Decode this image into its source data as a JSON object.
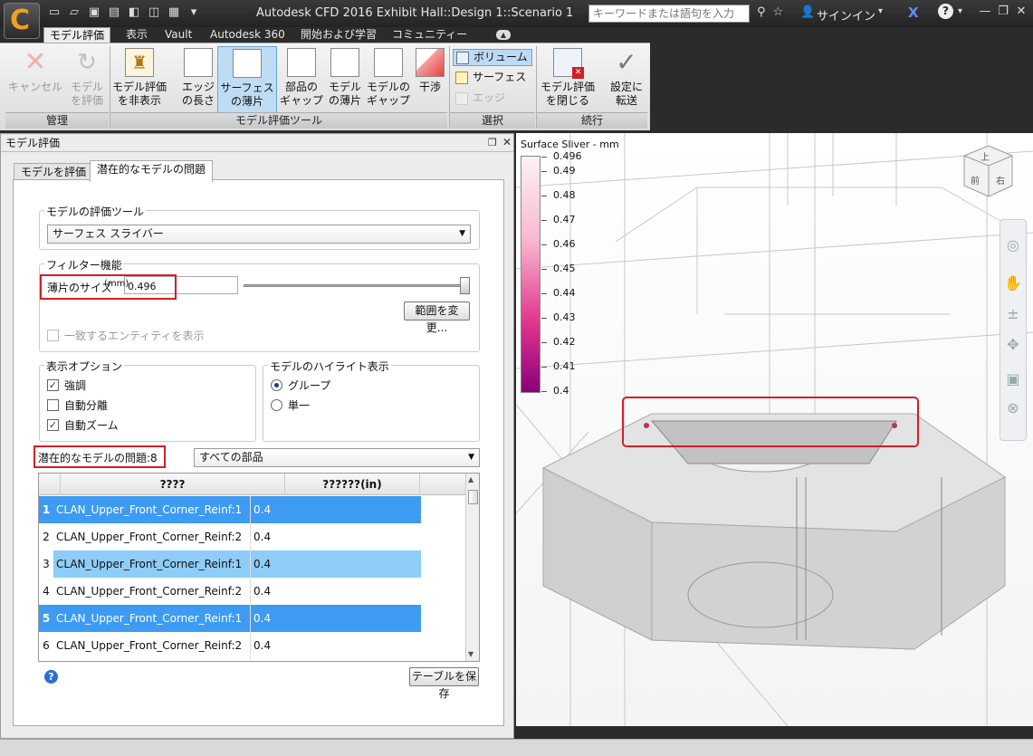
{
  "window": {
    "title": "Autodesk CFD 2016   Exhibit Hall::Design 1::Scenario 1",
    "search_placeholder": "キーワードまたは語句を入力",
    "signin": "サインイン"
  },
  "ribbon_tabs": [
    "モデル評価",
    "表示",
    "Vault",
    "Autodesk 360",
    "開始および学習",
    "コミュニティー"
  ],
  "ribbon": {
    "manage": {
      "label": "管理",
      "cancel": "キャンセル",
      "evaluate_model": [
        "モデル",
        "を評価"
      ]
    },
    "tools": {
      "label": "モデル評価ツール",
      "hide_model_eval": [
        "モデル評価",
        "を非表示"
      ],
      "edge_length": [
        "エッジ",
        "の長さ"
      ],
      "surface_sliver": [
        "サーフェス",
        "の薄片"
      ],
      "part_gap": [
        "部品の",
        "ギャップ"
      ],
      "model_sliver": [
        "モデル",
        "の薄片"
      ],
      "model_gap": [
        "モデルの",
        "ギャップ"
      ],
      "interference": "干渉"
    },
    "select": {
      "label": "選択",
      "volume": "ボリューム",
      "surface": "サーフェス",
      "edge": "エッジ"
    },
    "continue": {
      "label": "続行",
      "close_model_eval": [
        "モデル評価",
        "を閉じる"
      ],
      "transfer_to_setup": [
        "設定に",
        "転送"
      ]
    }
  },
  "panel": {
    "title": "モデル評価",
    "tabs": [
      "モデルを評価",
      "潜在的なモデルの問題"
    ],
    "eval_tool_group": "モデルの評価ツール",
    "eval_tool_value": "サーフェス スライバー",
    "filter_group": "フィルター機能",
    "sliver_size_label": "薄片のサイズ",
    "sliver_unit": "(mm)",
    "sliver_value": "0.496",
    "change_range_button": "範囲を変更...",
    "show_matching": "一致するエンティティを表示",
    "display_options_group": "表示オプション",
    "display_options": [
      {
        "label": "強調",
        "checked": true
      },
      {
        "label": "自動分離",
        "checked": false
      },
      {
        "label": "自動ズーム",
        "checked": true
      }
    ],
    "highlight_group": "モデルのハイライト表示",
    "highlight_options": [
      {
        "label": "グループ",
        "selected": true
      },
      {
        "label": "単一",
        "selected": false
      }
    ],
    "issues_label": "潜在的なモデルの問題:",
    "issues_count": "8",
    "parts_filter": "すべての部品",
    "table": {
      "headers": [
        "????",
        "??????(in)"
      ],
      "rows": [
        {
          "num": "1",
          "name": "CLAN_Upper_Front_Corner_Reinf:1",
          "value": "0.4",
          "state": "sel-dark"
        },
        {
          "num": "2",
          "name": "CLAN_Upper_Front_Corner_Reinf:2",
          "value": "0.4",
          "state": "plain"
        },
        {
          "num": "3",
          "name": "CLAN_Upper_Front_Corner_Reinf:1",
          "value": "0.4",
          "state": "sel-light"
        },
        {
          "num": "4",
          "name": "CLAN_Upper_Front_Corner_Reinf:2",
          "value": "0.4",
          "state": "plain"
        },
        {
          "num": "5",
          "name": "CLAN_Upper_Front_Corner_Reinf:1",
          "value": "0.4",
          "state": "sel-dark"
        },
        {
          "num": "6",
          "name": "CLAN_Upper_Front_Corner_Reinf:2",
          "value": "0.4",
          "state": "plain"
        }
      ]
    },
    "save_table_button": "テーブルを保存"
  },
  "viewport": {
    "legend_title": "Surface Sliver - mm",
    "legend_values": [
      "0.496",
      "0.49",
      "0.48",
      "0.47",
      "0.46",
      "0.45",
      "0.44",
      "0.43",
      "0.42",
      "0.41",
      "0.4"
    ],
    "viewcube": {
      "top": "上",
      "front": "前",
      "right": "右"
    }
  },
  "colors": {
    "accent_blue": "#3d9bf3",
    "highlight_red": "#d31e25",
    "legend_max": "#fdf1f4",
    "legend_min": "#8a007a"
  }
}
